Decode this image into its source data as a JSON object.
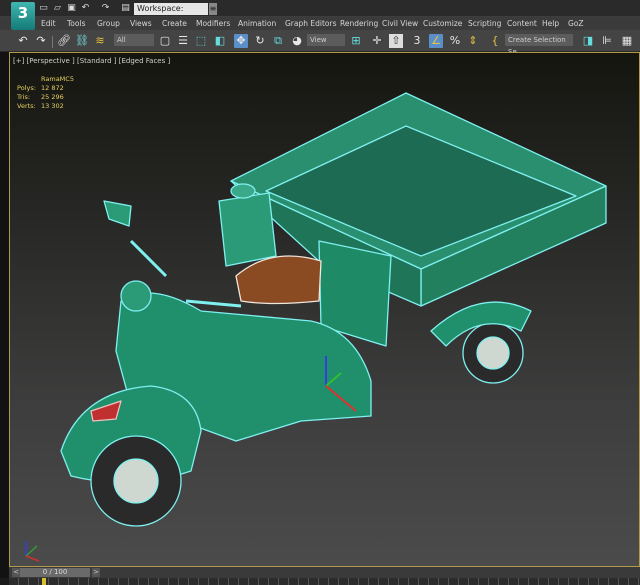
{
  "app": {
    "logo": "3",
    "workspace": "Workspace: Default"
  },
  "menu": [
    "Edit",
    "Tools",
    "Group",
    "Views",
    "Create",
    "Modifiers",
    "Animation",
    "Graph Editors",
    "Rendering",
    "Civil View",
    "Customize",
    "Scripting",
    "Content",
    "Help",
    "GoZ"
  ],
  "toolbar": {
    "selection_filter": "All",
    "ref_coord": "View",
    "named_selection": "Create Selection Se"
  },
  "viewport": {
    "label": "[+] [Perspective ] [Standard ] [Edged Faces ]",
    "object_name": "RamaMC5",
    "stats": [
      {
        "label": "Polys:",
        "value": "12 872"
      },
      {
        "label": "Tris:",
        "value": "25 296"
      },
      {
        "label": "Verts:",
        "value": "13 302"
      }
    ],
    "model_color": "#1f8f6c",
    "wire_color": "#7ff0f0",
    "border_color": "#b09a4a"
  },
  "timeline": {
    "frame": "0 / 100",
    "prev": "<",
    "next": ">"
  }
}
